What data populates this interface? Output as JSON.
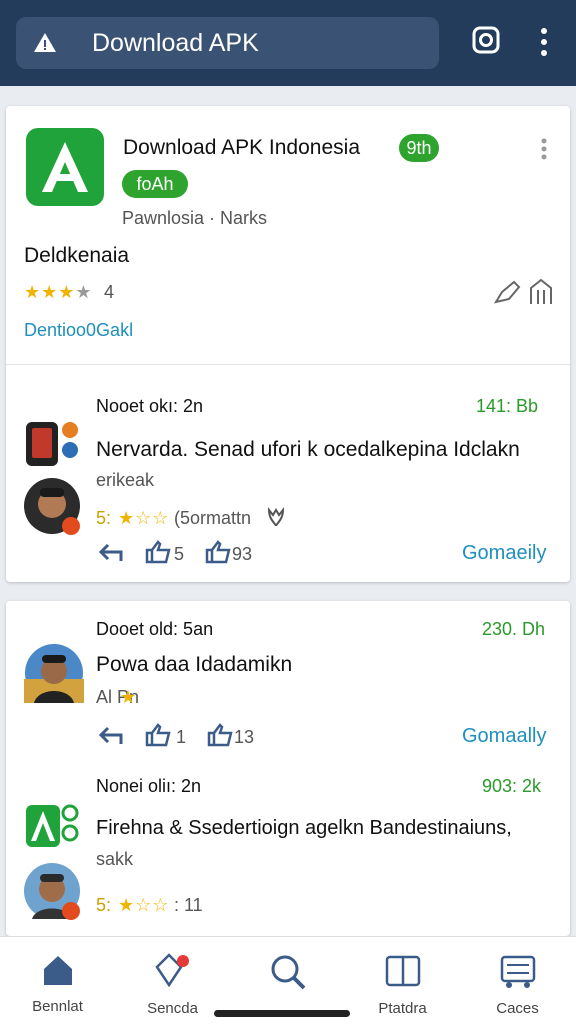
{
  "topbar": {
    "search_text": "Download APK",
    "icons": [
      "warning-icon",
      "instagram-icon",
      "more-vert-icon"
    ]
  },
  "app": {
    "name": "Download APK Indonesia",
    "name_badge": "9th",
    "tag": "foAh",
    "meta": "Pawnlosia · Narks",
    "title": "Deldkenaia",
    "rating": "4",
    "link": "Dentioo0Gakl"
  },
  "posts": [
    {
      "author": "Nooet okı: 2n",
      "stat": "141: Bb",
      "text": "Nervarda. Senad ufori k ocedalkepina Idclakn",
      "sub": "erikeak",
      "rating_prefix": "5:",
      "rating_note": "(5ormattn",
      "reply_count": "",
      "like_count": "5",
      "share_count": "93",
      "action": "Gomaeily"
    },
    {
      "author": "Dooet old: 5an",
      "stat": "230. Dh",
      "text": "Powa daa Idadamikn",
      "sub": "Al Pn",
      "like_count": "1",
      "share_count": "13",
      "action": "Gomaally"
    },
    {
      "author": "Nonei oliı: 2n",
      "stat": "903: 2k",
      "text": "Firehna & Ssedertioign agelkn Bandestinaiuns,",
      "sub": "sakk",
      "rating_prefix": "5:",
      "rating_note": ": 11"
    }
  ],
  "nav": [
    {
      "label": "Bennlat",
      "icon": "home-icon"
    },
    {
      "label": "Sencda",
      "icon": "tag-icon"
    },
    {
      "label": "",
      "icon": "search-icon"
    },
    {
      "label": "Ptatdra",
      "icon": "files-icon"
    },
    {
      "label": "Caces",
      "icon": "cart-icon"
    }
  ],
  "colors": {
    "topbar": "#233c5b",
    "accent_green": "#2ea32e",
    "link_blue": "#1f8fbf",
    "star": "#f0b400"
  }
}
